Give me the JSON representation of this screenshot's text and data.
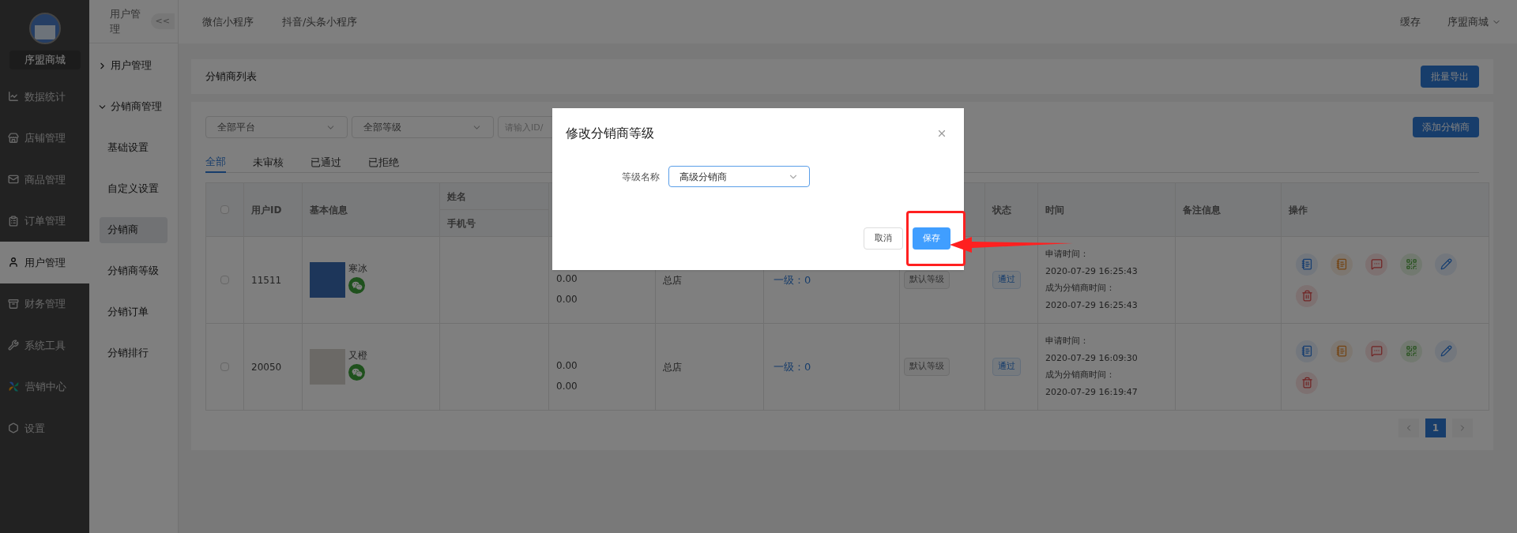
{
  "sidebar": {
    "store_name": "序盟商城",
    "items": [
      {
        "label": "数据统计",
        "selected": false
      },
      {
        "label": "店铺管理",
        "selected": false
      },
      {
        "label": "商品管理",
        "selected": false
      },
      {
        "label": "订单管理",
        "selected": false
      },
      {
        "label": "用户管理",
        "selected": true
      },
      {
        "label": "财务管理",
        "selected": false
      },
      {
        "label": "系统工具",
        "selected": false
      },
      {
        "label": "营销中心",
        "selected": false
      },
      {
        "label": "设置",
        "selected": false
      }
    ]
  },
  "subnav": {
    "title": "用户管理",
    "collapse_button": "<<",
    "groups": [
      {
        "label": "用户管理",
        "expanded": false
      },
      {
        "label": "分销商管理",
        "expanded": true,
        "children": [
          {
            "label": "基础设置",
            "selected": false
          },
          {
            "label": "自定义设置",
            "selected": false
          },
          {
            "label": "分销商",
            "selected": true
          },
          {
            "label": "分销商等级",
            "selected": false
          },
          {
            "label": "分销订单",
            "selected": false
          },
          {
            "label": "分销排行",
            "selected": false
          }
        ]
      }
    ]
  },
  "topbar": {
    "tabs": [
      "微信小程序",
      "抖音/头条小程序"
    ],
    "cache": "缓存",
    "account": "序盟商城"
  },
  "page_header": {
    "title": "分销商列表",
    "export_button": "批量导出"
  },
  "filters": {
    "platform": "全部平台",
    "level": "全部等级",
    "search_placeholder": "请输入ID/",
    "add_button": "添加分销商"
  },
  "status_tabs": [
    {
      "label": "全部",
      "selected": true
    },
    {
      "label": "未审核",
      "selected": false
    },
    {
      "label": "已通过",
      "selected": false
    },
    {
      "label": "已拒绝",
      "selected": false
    }
  ],
  "table": {
    "header": {
      "select_all_checked": false,
      "id": "用户ID",
      "basic": "基本信息",
      "name": "姓名",
      "phone": "手机号",
      "status": "状态",
      "time": "时间",
      "remark": "备注信息",
      "actions": "操作"
    },
    "rows": [
      {
        "checked": false,
        "id": "11511",
        "nickname": "寒冰",
        "amount_1": "0.00",
        "amount_2": "0.00",
        "store": "总店",
        "level_link": "一级：0",
        "level_tag": "默认等级",
        "status": "通过",
        "apply_label": "申请时间：",
        "apply_time": "2020-07-29 16:25:43",
        "join_label": "成为分销商时间：",
        "join_time": "2020-07-29 16:25:43"
      },
      {
        "checked": false,
        "id": "20050",
        "nickname": "又橙",
        "amount_1": "0.00",
        "amount_2": "0.00",
        "store": "总店",
        "level_link": "一级：0",
        "level_tag": "默认等级",
        "status": "通过",
        "apply_label": "申请时间：",
        "apply_time": "2020-07-29 16:09:30",
        "join_label": "成为分销商时间：",
        "join_time": "2020-07-29 16:19:47"
      }
    ]
  },
  "pagination": [
    {
      "label": "1",
      "selected": true
    }
  ],
  "modal": {
    "title": "修改分销商等级",
    "field_label": "等级名称",
    "field_value": "高级分销商",
    "cancel_button": "取消",
    "save_button": "保存"
  }
}
